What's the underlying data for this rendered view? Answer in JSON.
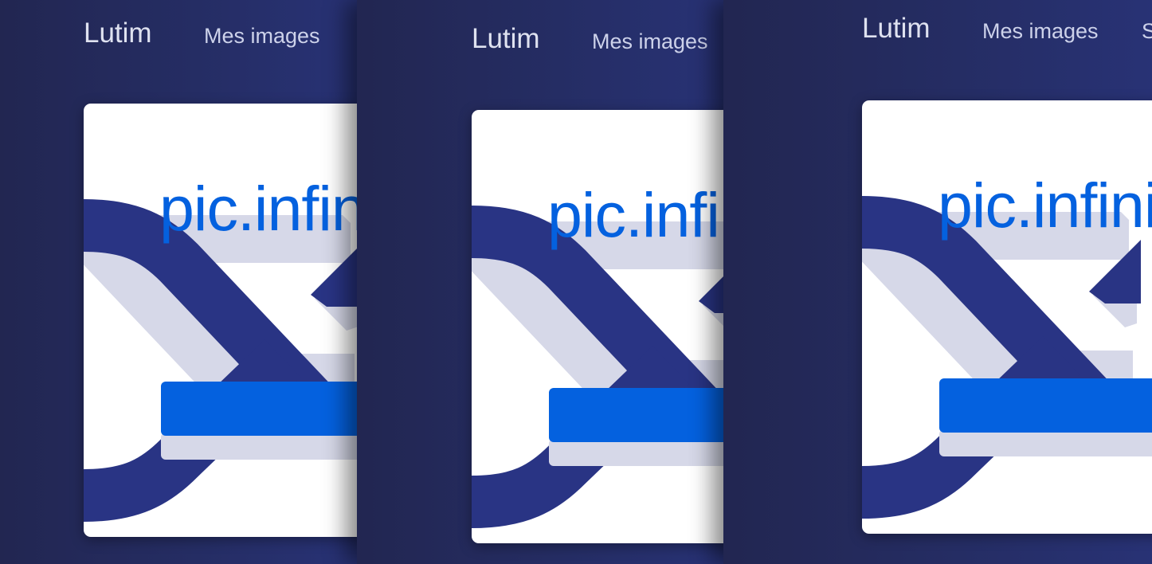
{
  "nav": {
    "brand": "Lutim",
    "my_images": "Mes images",
    "next_item": "S"
  },
  "card": {
    "title": "pic.infini.fr"
  },
  "colors": {
    "background": "#222752",
    "accent": "#0461df",
    "logo_navy": "#293484",
    "logo_shadow": "#d6d8e8"
  }
}
